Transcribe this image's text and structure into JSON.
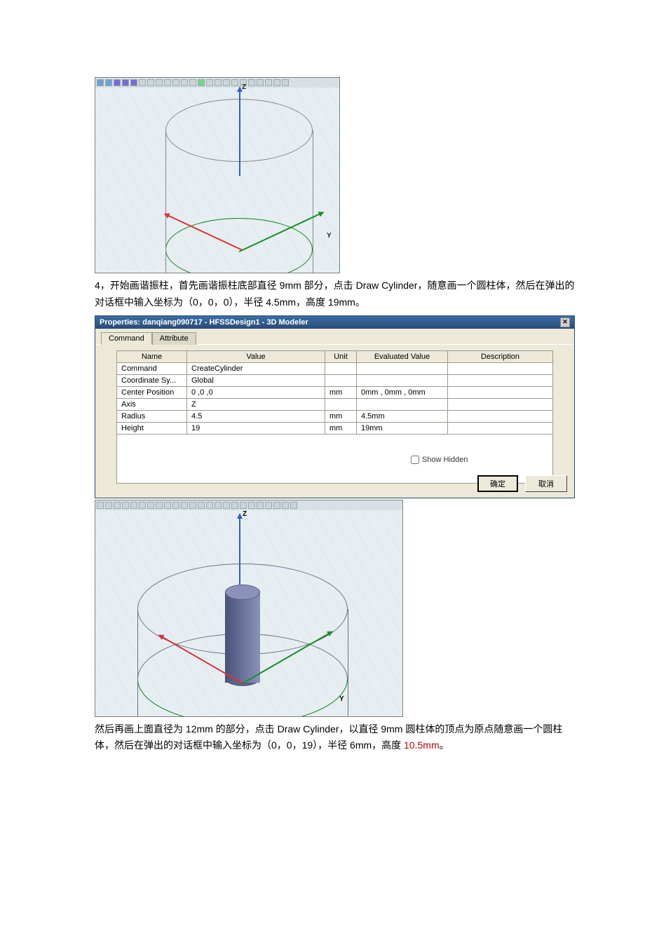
{
  "figure1": {
    "axis_z_label": "Z",
    "axis_y_label": "Y"
  },
  "paragraph1": "4，开始画谐振柱，首先画谐振柱底部直径 9mm 部分，点击 Draw Cylinder，随意画一个圆柱体，然后在弹出的对话框中输入坐标为（0，0，0），半径 4.5mm，高度 19mm。",
  "dialog": {
    "title": "Properties: danqiang090717 - HFSSDesign1 - 3D Modeler",
    "tabs": {
      "command": "Command",
      "attribute": "Attribute"
    },
    "headers": {
      "name": "Name",
      "value": "Value",
      "unit": "Unit",
      "evaluated": "Evaluated Value",
      "description": "Description"
    },
    "rows": [
      {
        "name": "Command",
        "value": "CreateCylinder",
        "unit": "",
        "evaluated": "",
        "description": ""
      },
      {
        "name": "Coordinate Sy...",
        "value": "Global",
        "unit": "",
        "evaluated": "",
        "description": ""
      },
      {
        "name": "Center Position",
        "value": "0 ,0 ,0",
        "unit": "mm",
        "evaluated": "0mm , 0mm , 0mm",
        "description": ""
      },
      {
        "name": "Axis",
        "value": "Z",
        "unit": "",
        "evaluated": "",
        "description": ""
      },
      {
        "name": "Radius",
        "value": "4.5",
        "unit": "mm",
        "evaluated": "4.5mm",
        "description": ""
      },
      {
        "name": "Height",
        "value": "19",
        "unit": "mm",
        "evaluated": "19mm",
        "description": ""
      }
    ],
    "show_hidden": "Show Hidden",
    "ok": "确定",
    "cancel": "取消"
  },
  "figure2": {
    "axis_z_label": "Z",
    "axis_y_label": "Y"
  },
  "paragraph2_part1": "  然后再画上面直径为 12mm 的部分，点击 Draw Cylinder，以直径 9mm 圆柱体的顶点为原点随意画一个圆柱体，然后在弹出的对话框中输入坐标为（0，0，19），半径 6mm，高度 ",
  "paragraph2_red": "10.5mm",
  "paragraph2_part2": "。"
}
